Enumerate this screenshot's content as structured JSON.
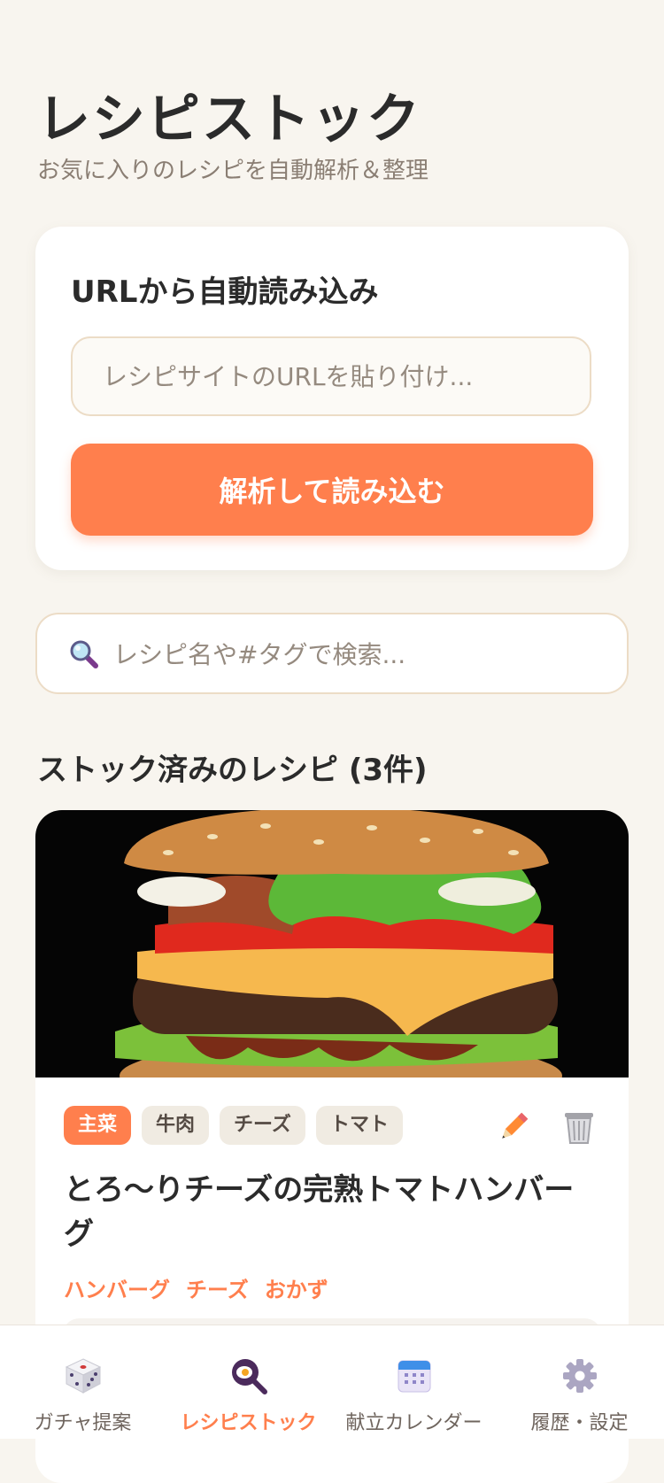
{
  "header": {
    "title": "レシピストック",
    "subtitle": "お気に入りのレシピを自動解析＆整理"
  },
  "url_import": {
    "title": "URLから自動読み込み",
    "placeholder": "レシピサイトのURLを貼り付け...",
    "button_label": "解析して読み込む"
  },
  "search": {
    "placeholder": "レシピ名や#タグで検索..."
  },
  "stock": {
    "section_title": "ストック済みのレシピ (3件)",
    "recipes": [
      {
        "tags": [
          "主菜",
          "牛肉",
          "チーズ",
          "トマト"
        ],
        "title": "とろ〜りチーズの完熟トマトハンバーグ",
        "hashtags": [
          "ハンバーグ",
          "チーズ",
          "おかず"
        ]
      }
    ]
  },
  "bottom_nav": {
    "items": [
      {
        "label": "ガチャ提案",
        "icon": "dice-icon"
      },
      {
        "label": "レシピストック",
        "icon": "frying-pan-icon",
        "active": true
      },
      {
        "label": "献立カレンダー",
        "icon": "calendar-icon"
      },
      {
        "label": "履歴・設定",
        "icon": "gear-icon"
      }
    ]
  },
  "colors": {
    "background": "#f8f5ef",
    "accent": "#ff7f4d",
    "card": "#ffffff",
    "text": "#2b2b2b",
    "muted": "#8a7e73"
  }
}
